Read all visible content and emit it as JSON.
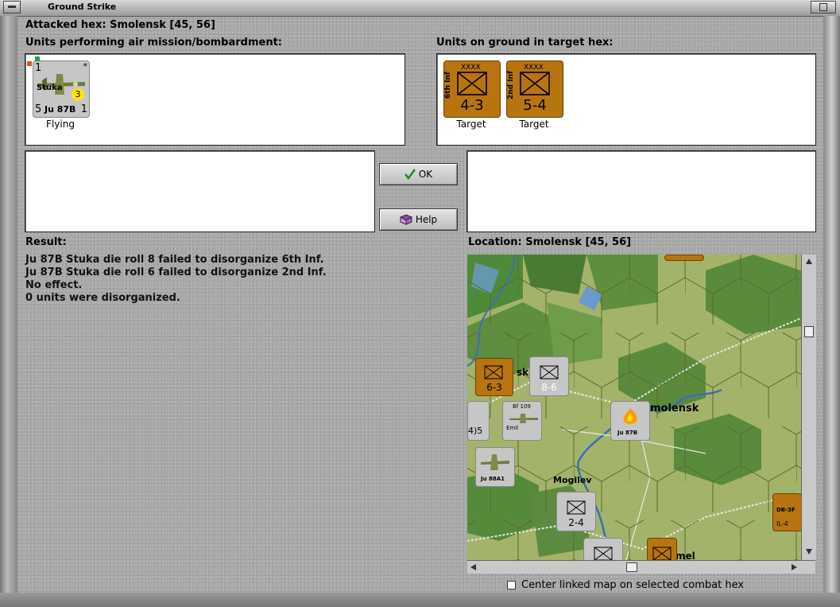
{
  "window": {
    "title": "Ground Strike"
  },
  "header": {
    "attacked_hex": "Attacked hex: Smolensk  [45, 56]"
  },
  "air_panel": {
    "label": "Units performing air mission/bombardment:",
    "units": [
      {
        "top_left": "1",
        "name": "Stuka",
        "badge": "3",
        "model": "Ju 87B",
        "bottom_left": "5",
        "bottom_right": "1",
        "status": "Flying"
      }
    ]
  },
  "ground_panel": {
    "label": "Units on ground in target hex:",
    "units": [
      {
        "side": "6th Inf",
        "size": "XXXX",
        "strength": "4-3",
        "status": "Target"
      },
      {
        "side": "2nd Inf",
        "size": "XXXX",
        "strength": "5-4",
        "status": "Target"
      }
    ]
  },
  "buttons": {
    "ok": "OK",
    "help": "Help"
  },
  "result": {
    "label": "Result:",
    "lines": [
      "Ju 87B Stuka die roll 8 failed to disorganize 6th Inf.",
      "Ju 87B Stuka die roll 6 failed to disorganize 2nd Inf.",
      "No effect.",
      "0 units were disorganized."
    ]
  },
  "location": {
    "label": "Location:  Smolensk  [45, 56]",
    "map_labels": {
      "smolensk": "molensk",
      "mogilev": "Mogilev",
      "gomel": "mel",
      "orsha": "sk"
    },
    "units": {
      "u63": "6-3",
      "u86": "8-6",
      "u24": "2-4",
      "u45": "4)5",
      "bf109": "Bf 109",
      "emil": "Emil",
      "ju88": "Ju 88A1",
      "ju87": "Ju 87B",
      "db3f": "DB-3F",
      "il4": "IL-4"
    }
  },
  "options": {
    "center_linked": "Center linked map on selected combat hex"
  }
}
